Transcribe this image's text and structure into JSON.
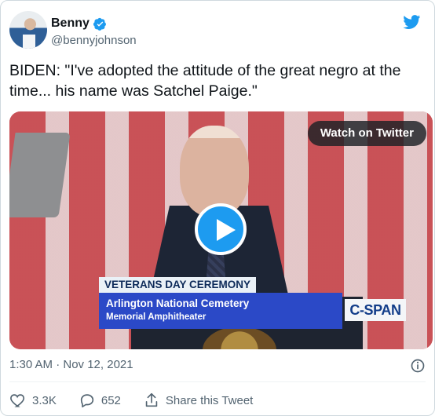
{
  "user": {
    "display_name": "Benny",
    "handle": "@bennyjohnson",
    "verified": true
  },
  "tweet": {
    "text": "BIDEN: \"I've adopted the attitude of the great negro at the time... his name was Satchel Paige.\"",
    "timestamp": "1:30 AM · Nov 12, 2021"
  },
  "media": {
    "watch_label": "Watch on Twitter",
    "banner_title": "VETERANS DAY CEREMONY",
    "banner_line1": "Arlington National Cemetery",
    "banner_line2": "Memorial Amphitheater",
    "network_logo_text": "C-SPAN"
  },
  "actions": {
    "like_count": "3.3K",
    "reply_count": "652",
    "share_label": "Share this Tweet"
  },
  "icons": {
    "bird": "twitter-bird-icon",
    "verified": "verified-badge-icon",
    "play": "play-icon",
    "info": "info-icon",
    "like": "heart-icon",
    "reply": "reply-bubble-icon",
    "share": "share-icon"
  },
  "colors": {
    "brand_blue": "#1d9bf0",
    "secondary_text": "#536471"
  }
}
